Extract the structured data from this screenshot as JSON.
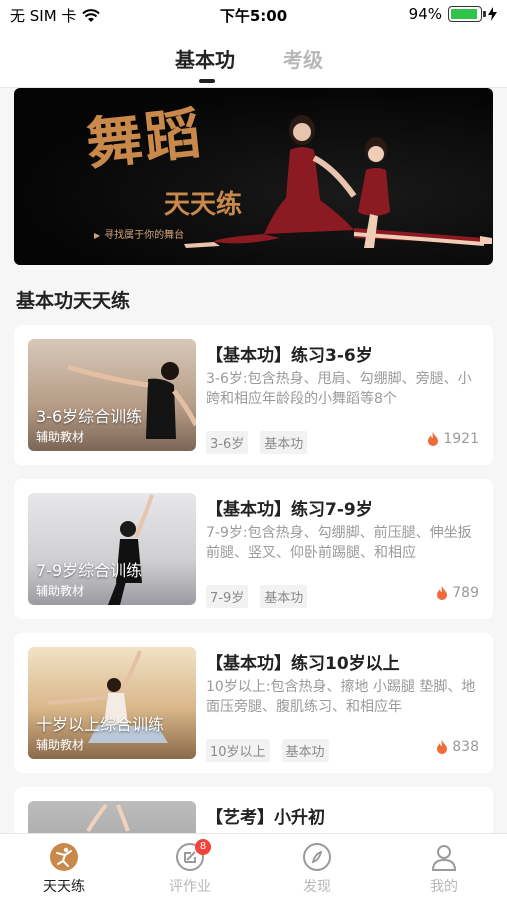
{
  "status": {
    "carrier": "无 SIM 卡",
    "time": "下午5:00",
    "battery": "94%",
    "battery_level": 0.94
  },
  "tabs": [
    {
      "label": "基本功",
      "active": true
    },
    {
      "label": "考级",
      "active": false
    }
  ],
  "banner": {
    "title": "舞蹈",
    "subtitle": "天天练",
    "tagline": "寻找属于你的舞台"
  },
  "section_title": "基本功天天练",
  "courses": [
    {
      "title": "【基本功】练习3-6岁",
      "desc": "3-6岁:包含热身、甩肩、勾绷脚、旁腿、小跨和相应年龄段的小舞蹈等8个",
      "thumb_label": "3-6岁综合训练",
      "thumb_sub": "辅助教材",
      "tags": [
        "3-6岁",
        "基本功"
      ],
      "views": "1921"
    },
    {
      "title": "【基本功】练习7-9岁",
      "desc": "7-9岁:包含热身、勾绷脚、前压腿、伸坐扳前腿、竖叉、仰卧前踢腿、和相应",
      "thumb_label": "7-9岁综合训练",
      "thumb_sub": "辅助教材",
      "tags": [
        "7-9岁",
        "基本功"
      ],
      "views": "789"
    },
    {
      "title": "【基本功】练习10岁以上",
      "desc": "10岁以上:包含热身、擦地 小踢腿 垫脚、地面压旁腿、腹肌练习、和相应年",
      "thumb_label": "十岁以上综合训练",
      "thumb_sub": "辅助教材",
      "tags": [
        "10岁以上",
        "基本功"
      ],
      "views": "838"
    },
    {
      "title": "【艺考】小升初",
      "desc": "",
      "thumb_label": "",
      "thumb_sub": "",
      "tags": [],
      "views": ""
    }
  ],
  "nav": [
    {
      "label": "天天练",
      "icon": "dance-icon",
      "active": true
    },
    {
      "label": "评作业",
      "icon": "edit-icon",
      "active": false,
      "badge": "8"
    },
    {
      "label": "发现",
      "icon": "compass-icon",
      "active": false
    },
    {
      "label": "我的",
      "icon": "user-icon",
      "active": false
    }
  ],
  "colors": {
    "accent": "#c9894a",
    "badge": "#f4423a",
    "battery": "#31c24a",
    "fire": "#f06a3a"
  }
}
